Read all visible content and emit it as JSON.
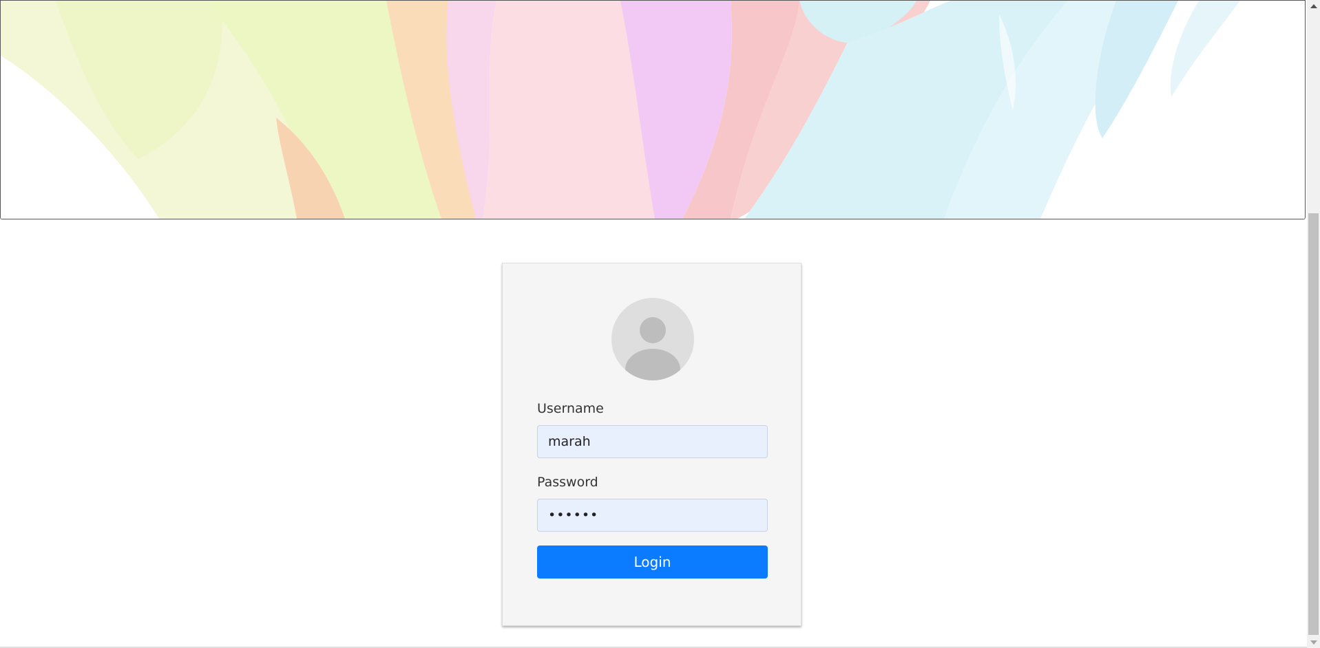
{
  "login": {
    "username_label": "Username",
    "username_value": "marah",
    "password_label": "Password",
    "password_value": "marah1",
    "button_label": "Login"
  },
  "colors": {
    "button": "#0b7cff",
    "card_background": "#f5f5f5",
    "input_autofill": "#e8f0fe"
  },
  "icons": {
    "avatar": "user-avatar-icon",
    "scroll_up": "scroll-up-arrow-icon",
    "scroll_down": "scroll-down-arrow-icon"
  }
}
